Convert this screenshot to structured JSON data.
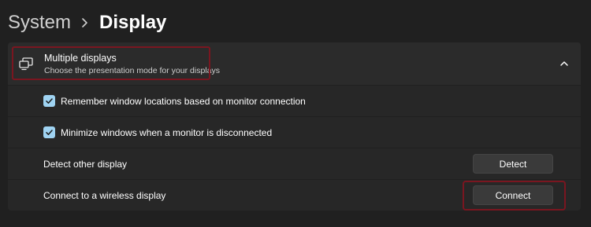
{
  "breadcrumb": {
    "parent": "System",
    "current": "Display"
  },
  "multiple_displays": {
    "title": "Multiple displays",
    "subtitle": "Choose the presentation mode for your displays",
    "icon": "multiple-displays-icon",
    "expanded": true
  },
  "settings": {
    "remember_window_locations": {
      "label": "Remember window locations based on monitor connection",
      "checked": true
    },
    "minimize_windows": {
      "label": "Minimize windows when a monitor is disconnected",
      "checked": true
    },
    "detect_other_display": {
      "label": "Detect other display",
      "button_label": "Detect"
    },
    "connect_wireless": {
      "label": "Connect to a wireless display",
      "button_label": "Connect"
    }
  },
  "colors": {
    "background": "#202020",
    "card": "#2b2b2b",
    "accent_checkbox": "#9fd3f2",
    "highlight_outline": "#7a1620"
  }
}
